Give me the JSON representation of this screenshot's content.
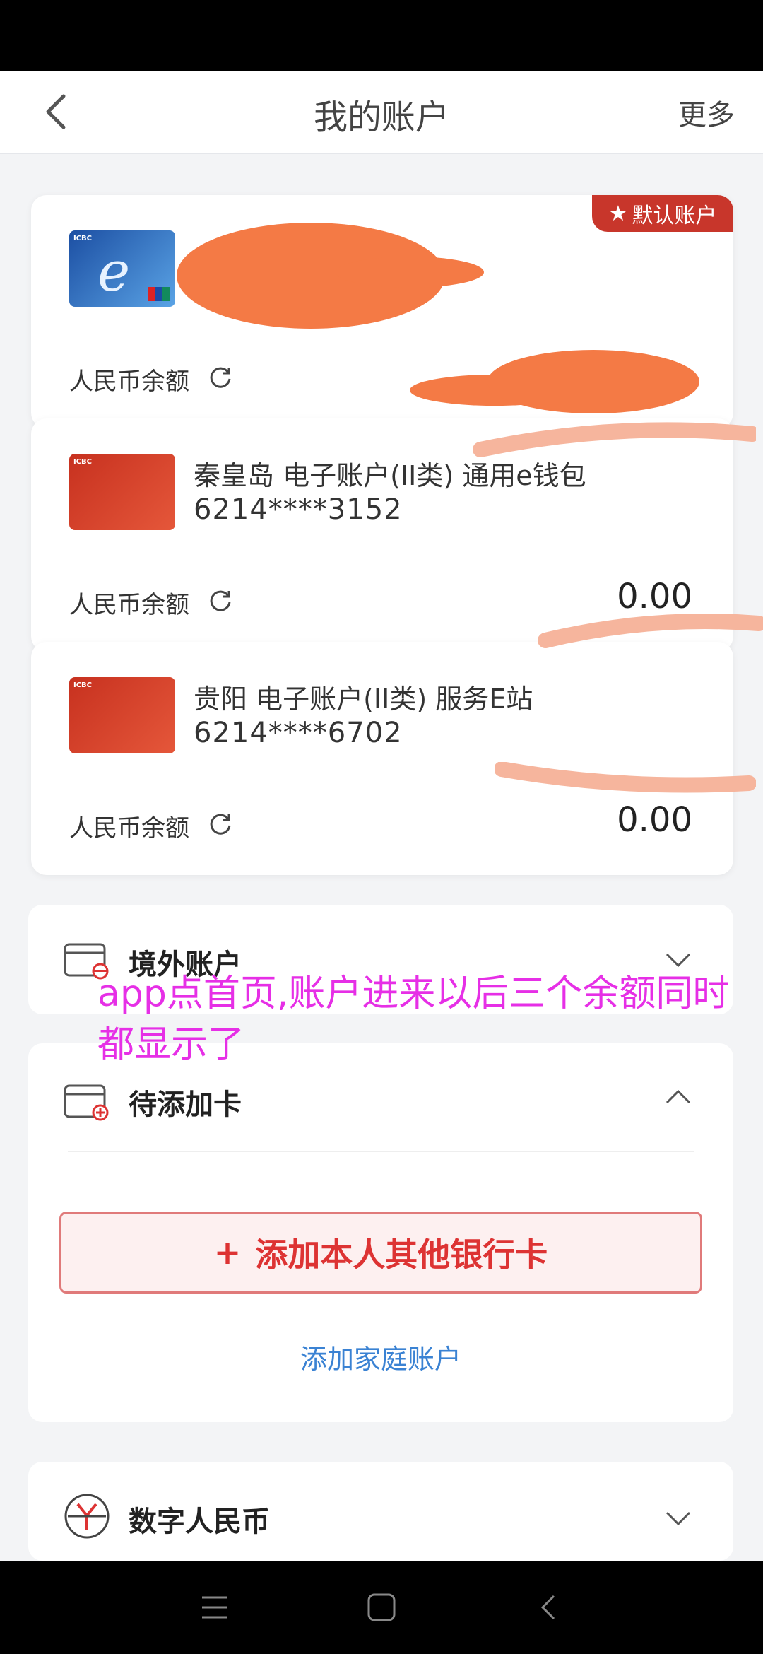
{
  "header": {
    "title": "我的账户",
    "more_label": "更多"
  },
  "accounts": [
    {
      "badge": "默认账户",
      "name": "",
      "number": "",
      "balance_label": "人民币余额",
      "balance": "",
      "card_style": "blue",
      "redacted": true
    },
    {
      "name": "秦皇岛 电子账户(II类) 通用e钱包",
      "number": "6214****3152",
      "balance_label": "人民币余额",
      "balance": "0.00",
      "card_style": "red"
    },
    {
      "name": "贵阳 电子账户(II类) 服务E站",
      "number": "6214****6702",
      "balance_label": "人民币余额",
      "balance": "0.00",
      "card_style": "red"
    }
  ],
  "sections": {
    "overseas": {
      "title": "境外账户"
    },
    "pending": {
      "title": "待添加卡",
      "add_button": "添加本人其他银行卡",
      "family_link": "添加家庭账户"
    },
    "digital_rmb": {
      "title": "数字人民币"
    }
  },
  "annotation": "app点首页,账户进来以后三个余额同时都显示了",
  "colors": {
    "accent_red": "#c8362b",
    "link_blue": "#3a82d3",
    "annotation_magenta": "#e62fe6",
    "scribble_orange": "#f47a45"
  }
}
